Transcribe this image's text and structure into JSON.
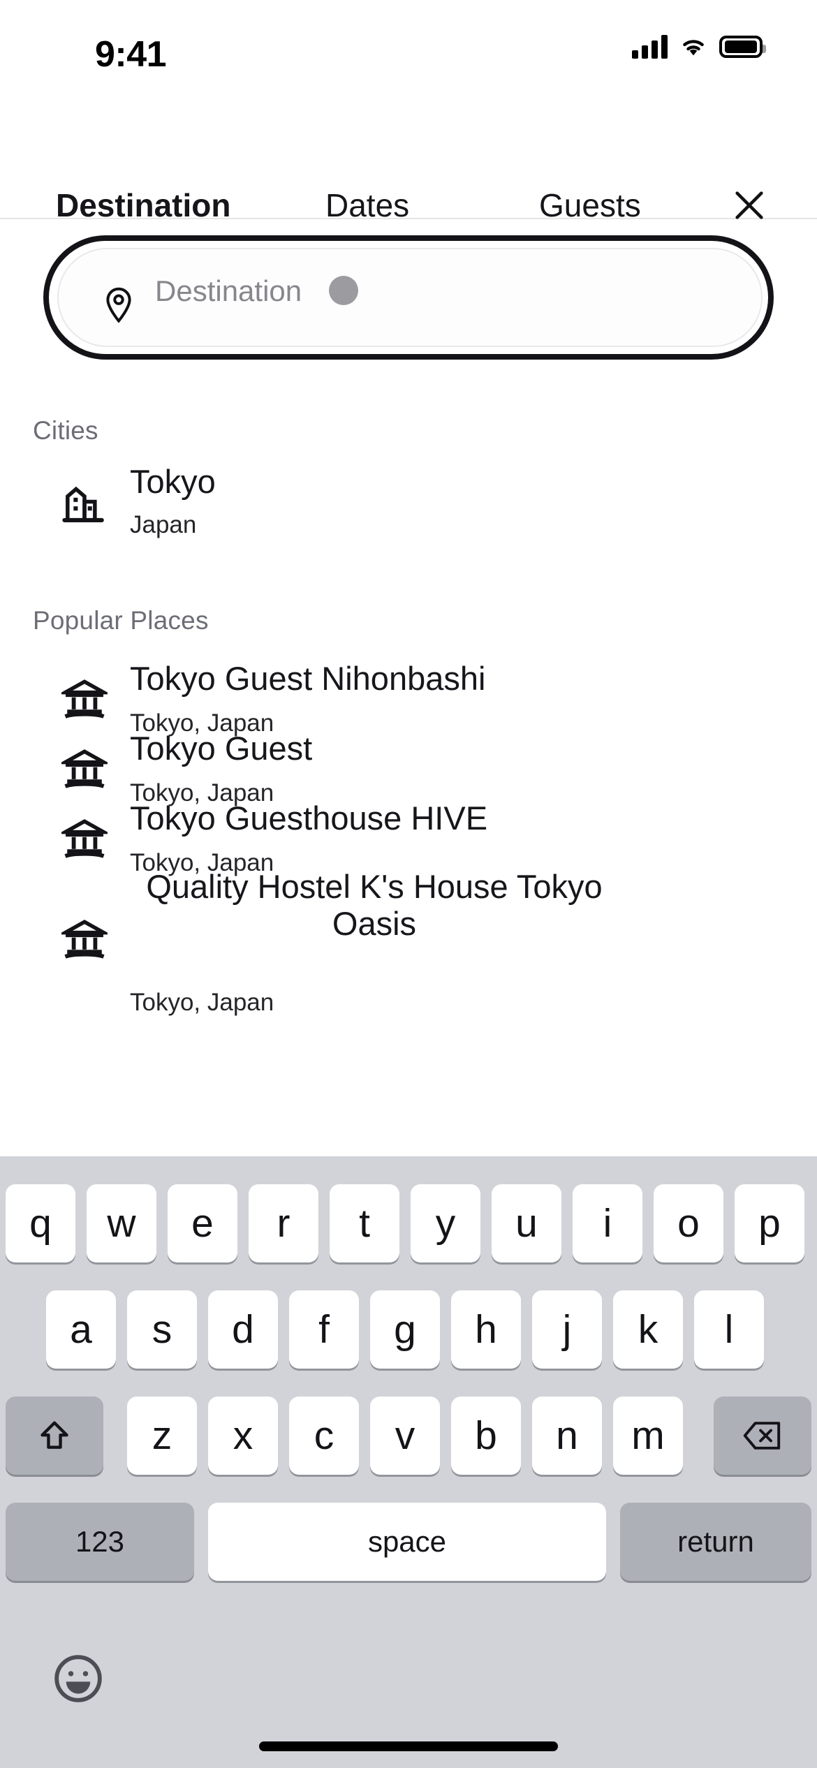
{
  "status_bar": {
    "time": "9:41",
    "signal_icon": "cellular-signal-icon",
    "wifi_icon": "wifi-icon",
    "battery_icon": "battery-full-icon"
  },
  "tabs": {
    "items": [
      {
        "label": "Destination",
        "active": true
      },
      {
        "label": "Dates",
        "active": false
      },
      {
        "label": "Guests",
        "active": false
      }
    ],
    "close_label": "close-icon"
  },
  "search": {
    "placeholder": "Destination",
    "value": "",
    "icon": "location-pin-icon"
  },
  "sections": [
    {
      "label": "Cities",
      "items": [
        {
          "icon": "city-buildings-icon",
          "title": "Tokyo",
          "subtitle": "Japan"
        }
      ]
    },
    {
      "label": "Popular Places",
      "items": [
        {
          "icon": "landmark-icon",
          "title": "Tokyo Guest Nihonbashi",
          "subtitle": "Tokyo, Japan"
        },
        {
          "icon": "landmark-icon",
          "title": "Tokyo Guest",
          "subtitle": "Tokyo, Japan"
        },
        {
          "icon": "landmark-icon",
          "title": "Tokyo Guesthouse HIVE",
          "subtitle": "Tokyo, Japan"
        },
        {
          "icon": "landmark-icon",
          "title": "Quality Hostel K's House Tokyo Oasis",
          "subtitle": "Tokyo, Japan"
        }
      ]
    }
  ],
  "keyboard": {
    "row1": [
      "q",
      "w",
      "e",
      "r",
      "t",
      "y",
      "u",
      "i",
      "o",
      "p"
    ],
    "row2": [
      "a",
      "s",
      "d",
      "f",
      "g",
      "h",
      "j",
      "k",
      "l"
    ],
    "row3": [
      "z",
      "x",
      "c",
      "v",
      "b",
      "n",
      "m"
    ],
    "shift_label": "shift-icon",
    "backspace_label": "backspace-icon",
    "numbers_label": "123",
    "space_label": "space",
    "return_label": "return",
    "emoji_label": "emoji-smiley-icon"
  },
  "colors": {
    "accent": "#111114",
    "text_primary": "#16161b",
    "text_secondary": "#6d6d76",
    "keyboard_bg": "#d2d3d8",
    "key_bg": "#ffffff",
    "key_mod_bg": "#aeb0b8"
  }
}
